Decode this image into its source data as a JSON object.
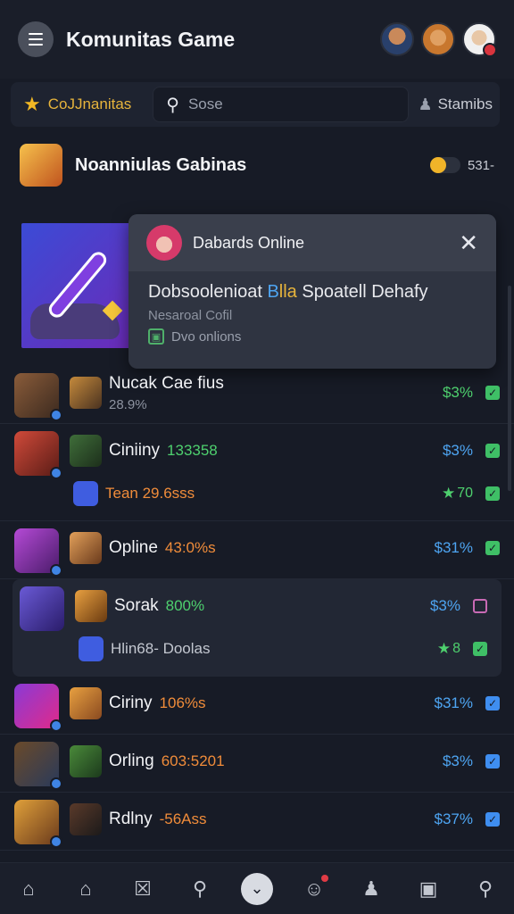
{
  "header": {
    "title": "Komunitas Game"
  },
  "search": {
    "community_label": "CoJJnanitas",
    "placeholder": "Sose",
    "team_label": "Stamibs"
  },
  "featured": {
    "title": "Noanniulas Gabinas",
    "value": "531-"
  },
  "popup": {
    "name": "Dabards Online",
    "headline_pre": "Dobsoolenioat",
    "headline_b": "B",
    "headline_ll": "lla",
    "headline_post": "Spoatell Dehafy",
    "sub": "Nesaroal Cofil",
    "status": "Dvo onlions"
  },
  "rows": [
    {
      "title": "Nucak Cae fius",
      "sub": "28.9%",
      "pct": "$3%",
      "pct_color": "green",
      "check": "green"
    },
    {
      "title": "Ciniiny",
      "sub": "133358",
      "pct": "$3%",
      "pct_color": "blue",
      "check": "green",
      "sub2": "Tean 29.6sss",
      "sub2_value": "70",
      "check2": "green"
    },
    {
      "title": "Opline",
      "sub": "43:0%s",
      "pct": "$31%",
      "pct_color": "blue",
      "check": "green"
    },
    {
      "title": "Sorak",
      "sub": "800%",
      "pct": "$3%",
      "pct_color": "blue",
      "check": "pink",
      "sub2": "Hlin68- Doolas",
      "sub2_value": "8",
      "check2": "green"
    },
    {
      "title": "Ciriny",
      "sub": "106%s",
      "pct": "$31%",
      "pct_color": "blue",
      "check": "blue"
    },
    {
      "title": "Orling",
      "sub": "603:5201",
      "pct": "$3%",
      "pct_color": "blue",
      "check": "blue"
    },
    {
      "title": "Rdlny",
      "sub": "-56Ass",
      "pct": "$37%",
      "pct_color": "blue",
      "check": "blue"
    }
  ],
  "icons": {
    "nav": [
      "home-icon",
      "house-icon",
      "inbox-icon",
      "search-icon",
      "chevron-down-icon",
      "emoji-icon",
      "friends-icon",
      "bag-icon",
      "search-icon"
    ]
  },
  "colors": {
    "bg": "#171b26",
    "accent_gold": "#e7b43c",
    "accent_blue": "#4ea5f2",
    "accent_green": "#4ed06e",
    "accent_orange": "#f08c3a"
  }
}
